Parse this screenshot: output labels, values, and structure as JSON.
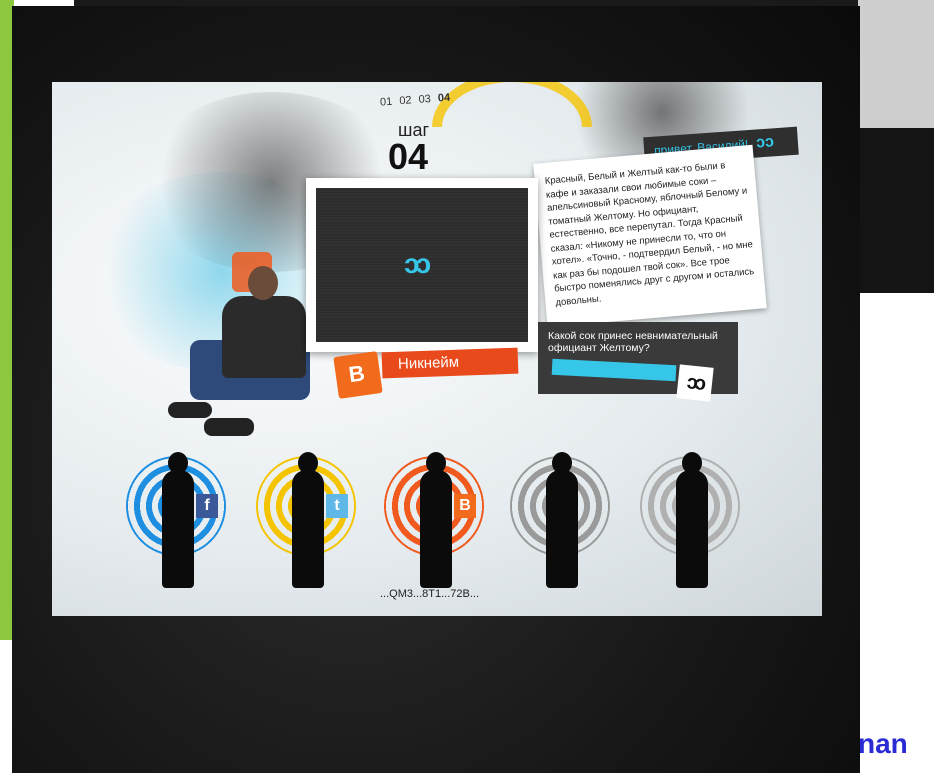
{
  "step": {
    "nav": [
      "01",
      "02",
      "03",
      "04"
    ],
    "current": "04",
    "title": "шаг",
    "number": "04"
  },
  "greeting": {
    "label": "привет, Василий!",
    "icon": "ↄↄ"
  },
  "story": {
    "text": "Красный, Белый и Желтый как-то были в кафе и заказали свои любимые соки – апельсиновый Красному, яблочный Белому и томатный Желтому. Но официант, естественно, все перепутал. Тогда Красный сказал: «Никому не принесли то, что он хотел». «Точно, - подтвердил Белый, - но мне как раз бы подошел твой сок». Все трое быстро поменялись друг с другом и остались довольны."
  },
  "video": {
    "play_icon": "ↄↄ"
  },
  "nickname": {
    "label": "Никнейм",
    "badge": "B"
  },
  "question": {
    "text": "Какой сок принес невнимательный официант Желтому?",
    "answer_value": "",
    "submit_icon": "ↄↄ"
  },
  "characters": [
    {
      "name": "guitarist",
      "ring_color": "#1e8fe0",
      "badge": "f",
      "badge_color": "#3b5998"
    },
    {
      "name": "standing-figure",
      "ring_color": "#f5c400",
      "badge": "t",
      "badge_color": "#5fb8e8"
    },
    {
      "name": "dancer",
      "ring_color": "#f05a1e",
      "badge": "B",
      "badge_color": "#f26a1b"
    },
    {
      "name": "figure-grey",
      "ring_color": "#9a9a9a",
      "badge": "",
      "badge_color": ""
    },
    {
      "name": "woman-figure",
      "ring_color": "#b0b0b0",
      "badge": "",
      "badge_color": ""
    }
  ],
  "captcha": "...QM3...8T1...72B...",
  "brand_tail": "nan",
  "colors": {
    "accent_cyan": "#36c6e8",
    "accent_orange": "#e84a1c",
    "green_bar": "#8dc63f",
    "dark_panel": "#3a3a3a"
  }
}
